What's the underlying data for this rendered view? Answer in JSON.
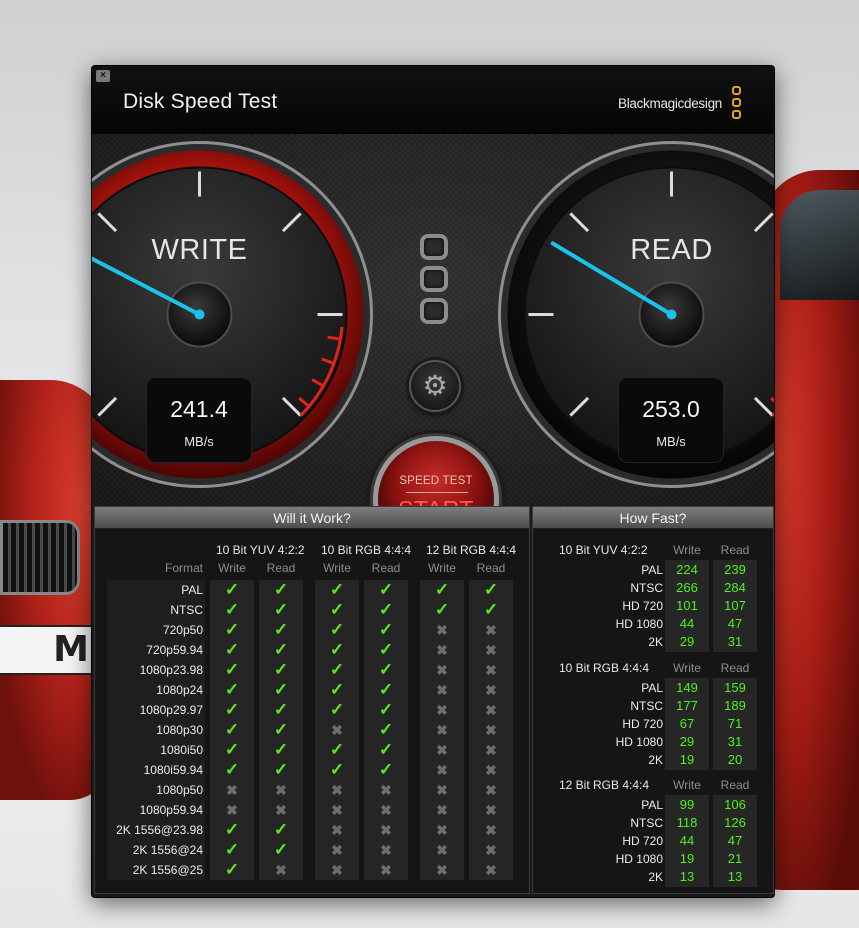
{
  "window": {
    "title": "Disk Speed Test",
    "brand": "Blackmagicdesign",
    "close_glyph": "×"
  },
  "colors": {
    "accent_red": "#c52a28",
    "needle_cyan": "#19c3ea",
    "ok_green": "#5de81e",
    "speed_green": "#4df21a",
    "brand_gold": "#e0a325"
  },
  "icons": {
    "gear": "⚙",
    "check": "✓",
    "cross": "✖"
  },
  "write_gauge": {
    "label": "WRITE",
    "value": "241.4",
    "unit": "MB/s"
  },
  "read_gauge": {
    "label": "READ",
    "value": "253.0",
    "unit": "MB/s"
  },
  "start_button": {
    "sub_label": "SPEED TEST",
    "label": "START"
  },
  "will_it_work": {
    "title": "Will it Work?",
    "format_header": "Format",
    "groups": [
      {
        "name": "10 Bit YUV 4:2:2",
        "write": "Write",
        "read": "Read"
      },
      {
        "name": "10 Bit RGB 4:4:4",
        "write": "Write",
        "read": "Read"
      },
      {
        "name": "12 Bit RGB 4:4:4",
        "write": "Write",
        "read": "Read"
      }
    ],
    "rows": [
      {
        "format": "PAL",
        "results": [
          true,
          true,
          true,
          true,
          true,
          true
        ]
      },
      {
        "format": "NTSC",
        "results": [
          true,
          true,
          true,
          true,
          true,
          true
        ]
      },
      {
        "format": "720p50",
        "results": [
          true,
          true,
          true,
          true,
          false,
          false
        ]
      },
      {
        "format": "720p59.94",
        "results": [
          true,
          true,
          true,
          true,
          false,
          false
        ]
      },
      {
        "format": "1080p23.98",
        "results": [
          true,
          true,
          true,
          true,
          false,
          false
        ]
      },
      {
        "format": "1080p24",
        "results": [
          true,
          true,
          true,
          true,
          false,
          false
        ]
      },
      {
        "format": "1080p29.97",
        "results": [
          true,
          true,
          true,
          true,
          false,
          false
        ]
      },
      {
        "format": "1080p30",
        "results": [
          true,
          true,
          false,
          true,
          false,
          false
        ]
      },
      {
        "format": "1080i50",
        "results": [
          true,
          true,
          true,
          true,
          false,
          false
        ]
      },
      {
        "format": "1080i59.94",
        "results": [
          true,
          true,
          true,
          true,
          false,
          false
        ]
      },
      {
        "format": "1080p50",
        "results": [
          false,
          false,
          false,
          false,
          false,
          false
        ]
      },
      {
        "format": "1080p59.94",
        "results": [
          false,
          false,
          false,
          false,
          false,
          false
        ]
      },
      {
        "format": "2K 1556@23.98",
        "results": [
          true,
          true,
          false,
          false,
          false,
          false
        ]
      },
      {
        "format": "2K 1556@24",
        "results": [
          true,
          true,
          false,
          false,
          false,
          false
        ]
      },
      {
        "format": "2K 1556@25",
        "results": [
          true,
          false,
          false,
          false,
          false,
          false
        ]
      }
    ]
  },
  "how_fast": {
    "title": "How Fast?",
    "groups": [
      {
        "name": "10 Bit YUV 4:2:2",
        "write": "Write",
        "read": "Read",
        "rows": [
          {
            "format": "PAL",
            "write": "224",
            "read": "239"
          },
          {
            "format": "NTSC",
            "write": "266",
            "read": "284"
          },
          {
            "format": "HD 720",
            "write": "101",
            "read": "107"
          },
          {
            "format": "HD 1080",
            "write": "44",
            "read": "47"
          },
          {
            "format": "2K",
            "write": "29",
            "read": "31"
          }
        ]
      },
      {
        "name": "10 Bit RGB 4:4:4",
        "write": "Write",
        "read": "Read",
        "rows": [
          {
            "format": "PAL",
            "write": "149",
            "read": "159"
          },
          {
            "format": "NTSC",
            "write": "177",
            "read": "189"
          },
          {
            "format": "HD 720",
            "write": "67",
            "read": "71"
          },
          {
            "format": "HD 1080",
            "write": "29",
            "read": "31"
          },
          {
            "format": "2K",
            "write": "19",
            "read": "20"
          }
        ]
      },
      {
        "name": "12 Bit RGB 4:4:4",
        "write": "Write",
        "read": "Read",
        "rows": [
          {
            "format": "PAL",
            "write": "99",
            "read": "106"
          },
          {
            "format": "NTSC",
            "write": "118",
            "read": "126"
          },
          {
            "format": "HD 720",
            "write": "44",
            "read": "47"
          },
          {
            "format": "HD 1080",
            "write": "19",
            "read": "21"
          },
          {
            "format": "2K",
            "write": "13",
            "read": "13"
          }
        ]
      }
    ]
  }
}
